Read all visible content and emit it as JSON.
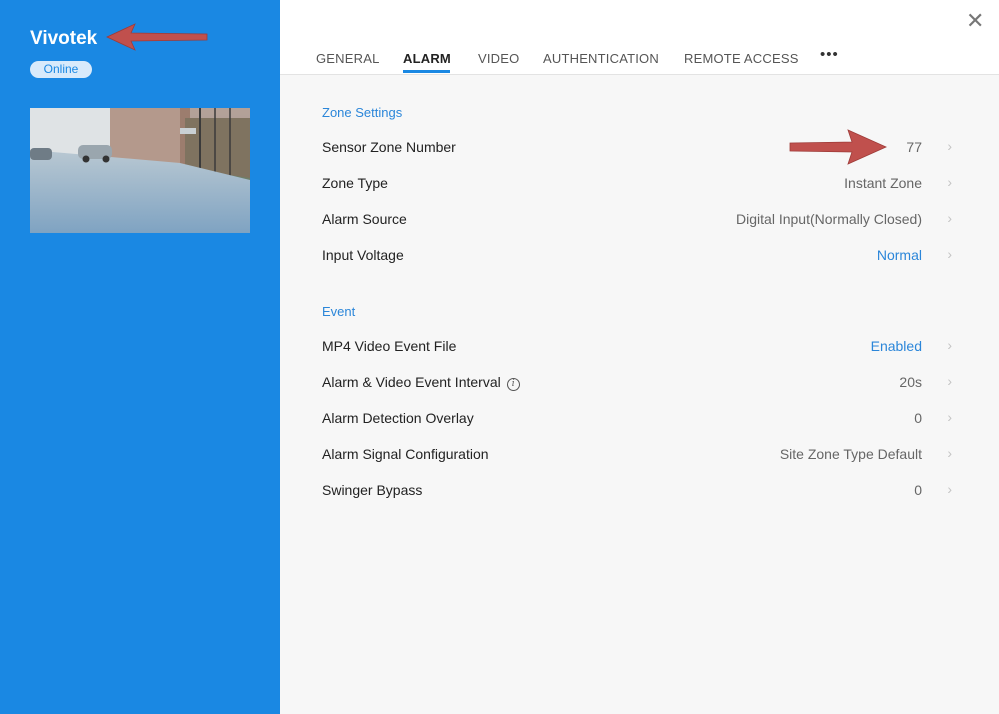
{
  "sidebar": {
    "device_name": "Vivotek",
    "status": "Online"
  },
  "tabs": [
    {
      "label": "GENERAL",
      "active": false
    },
    {
      "label": "ALARM",
      "active": true
    },
    {
      "label": "VIDEO",
      "active": false
    },
    {
      "label": "AUTHENTICATION",
      "active": false
    },
    {
      "label": "REMOTE ACCESS",
      "active": false
    }
  ],
  "more_label": "•••",
  "close_label": "✕",
  "zone_settings": {
    "title": "Zone Settings",
    "rows": [
      {
        "label": "Sensor Zone Number",
        "value": "77",
        "value_style": "muted"
      },
      {
        "label": "Zone Type",
        "value": "Instant Zone",
        "value_style": "muted"
      },
      {
        "label": "Alarm Source",
        "value": "Digital Input(Normally Closed)",
        "value_style": "muted"
      },
      {
        "label": "Input Voltage",
        "value": "Normal",
        "value_style": "link"
      }
    ]
  },
  "event": {
    "title": "Event",
    "rows": [
      {
        "label": "MP4 Video Event File",
        "value": "Enabled",
        "value_style": "link"
      },
      {
        "label": "Alarm & Video Event Interval",
        "value": "20s",
        "value_style": "muted",
        "info_icon": "i"
      },
      {
        "label": "Alarm Detection Overlay",
        "value": "0",
        "value_style": "muted"
      },
      {
        "label": "Alarm Signal Configuration",
        "value": "Site Zone Type Default",
        "value_style": "muted"
      },
      {
        "label": "Swinger Bypass",
        "value": "0",
        "value_style": "muted"
      }
    ]
  },
  "chevron": "›",
  "colors": {
    "sidebar": "#1a88e3",
    "accent": "#2b86d9",
    "annotation_arrow": "#c0504d"
  }
}
